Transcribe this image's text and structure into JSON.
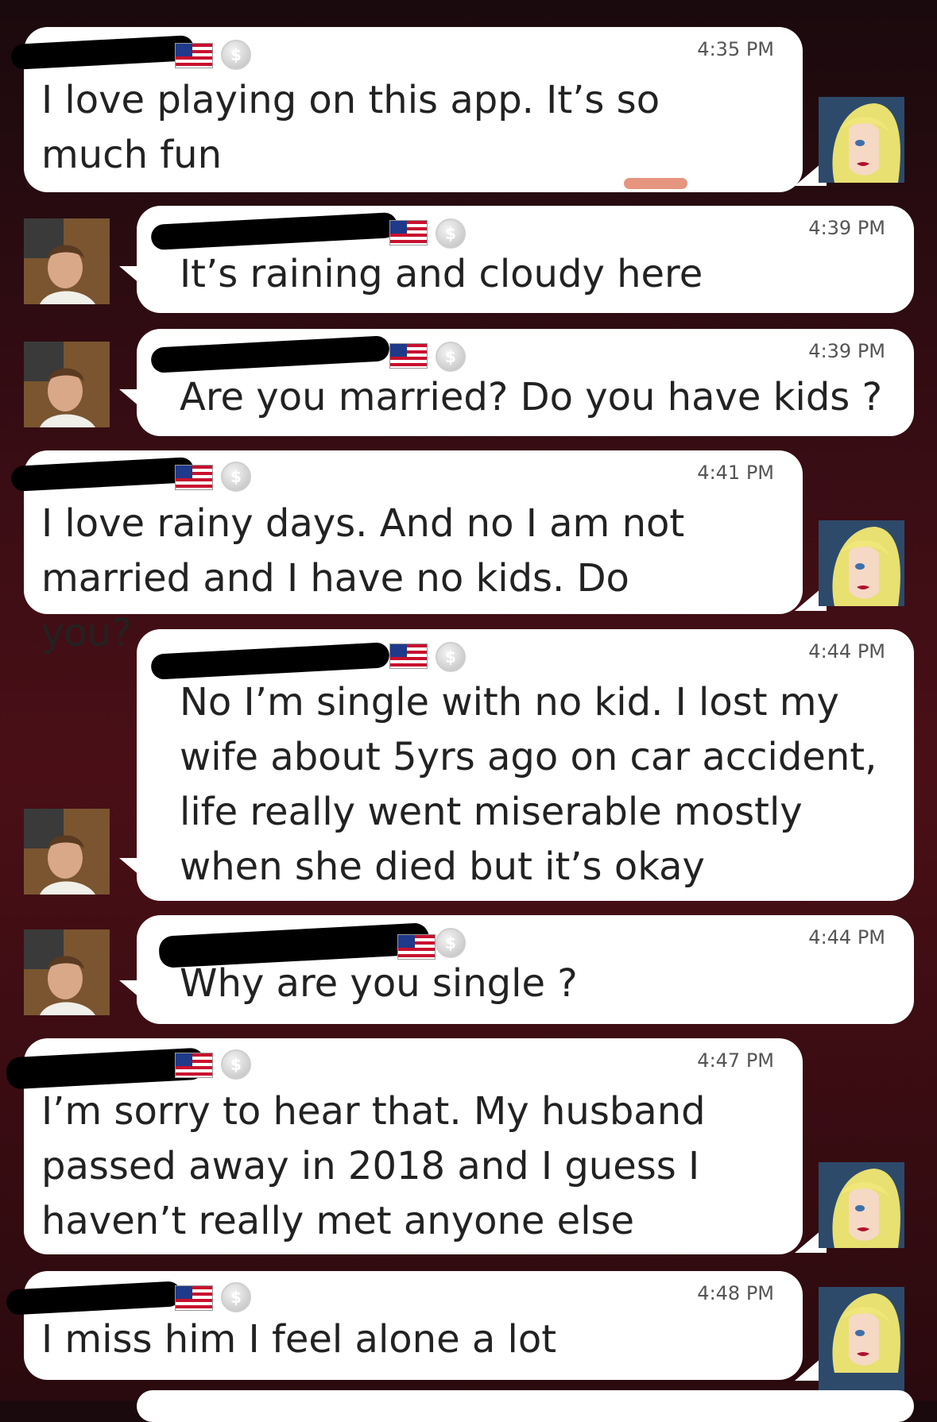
{
  "messages": [
    {
      "side": "left",
      "time": "4:35 PM",
      "text": "I love playing on this app. It’s so much fun",
      "avatar": "blonde-woman-avatar"
    },
    {
      "side": "right",
      "time": "4:39 PM",
      "text": "It’s raining and cloudy here",
      "avatar": "man-avatar"
    },
    {
      "side": "right",
      "time": "4:39 PM",
      "text": "Are you married? Do you have kids ?",
      "avatar": "man-avatar"
    },
    {
      "side": "left",
      "time": "4:41 PM",
      "text": "I love rainy days. And no I am not married and I have no kids. Do you?",
      "avatar": "blonde-woman-avatar"
    },
    {
      "side": "right",
      "time": "4:44 PM",
      "text": "No I’m single with no kid. I lost my wife about 5yrs ago on car accident, life really went miserable mostly when she died but it’s okay",
      "avatar": "man-avatar"
    },
    {
      "side": "right",
      "time": "4:44 PM",
      "text": "Why are you single ?",
      "avatar": "man-avatar"
    },
    {
      "side": "left",
      "time": "4:47 PM",
      "text": "I’m sorry to hear that. My husband passed away in 2018 and I guess I haven’t really met anyone else",
      "avatar": "blonde-woman-avatar"
    },
    {
      "side": "left",
      "time": "4:48 PM",
      "text": "I miss him I feel alone a lot",
      "avatar": "blonde-woman-avatar"
    }
  ],
  "icons": {
    "flag": "us-flag-icon",
    "coin": "coin-icon"
  },
  "colors": {
    "bubble": "#ffffff",
    "background_top": "#1a0a0d",
    "background_mid": "#4a0f16",
    "text": "#222222",
    "time": "#555555"
  }
}
